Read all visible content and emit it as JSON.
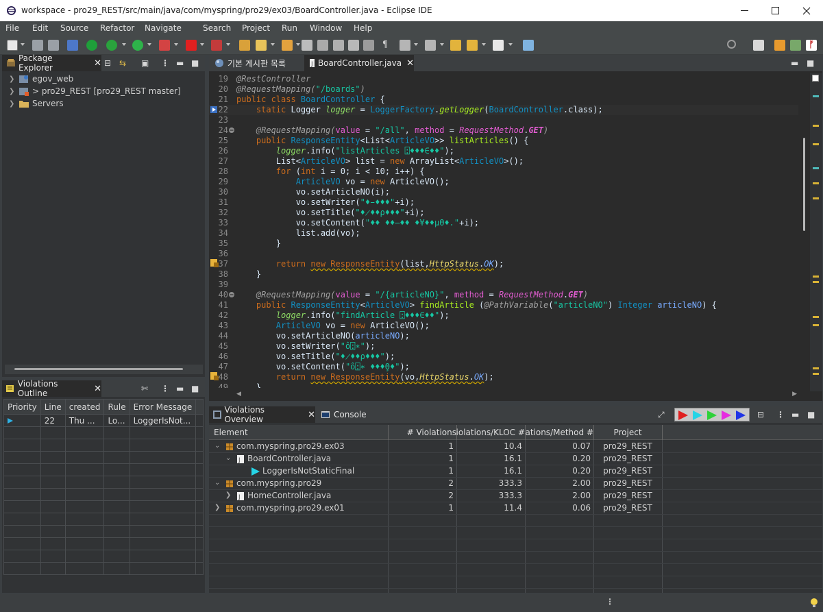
{
  "window": {
    "title": "workspace - pro29_REST/src/main/java/com/myspring/pro29/ex03/BoardController.java - Eclipse IDE"
  },
  "menu": [
    "File",
    "Edit",
    "Source",
    "Refactor",
    "Navigate",
    "Search",
    "Project",
    "Run",
    "Window",
    "Help"
  ],
  "package_explorer": {
    "tab_label": "Package Explorer",
    "items": [
      {
        "label": "egov_web"
      },
      {
        "label": "> pro29_REST [pro29_REST master]"
      },
      {
        "label": "Servers"
      }
    ]
  },
  "editor": {
    "tabs": [
      {
        "label": "기본 게시판 목록"
      },
      {
        "label": "BoardController.java"
      }
    ],
    "line_numbers": [
      "19",
      "20",
      "21",
      "22",
      "23",
      "24",
      "25",
      "26",
      "27",
      "28",
      "29",
      "30",
      "31",
      "32",
      "33",
      "34",
      "35",
      "36",
      "37",
      "38",
      "39",
      "40",
      "41",
      "42",
      "43",
      "44",
      "45",
      "46",
      "47",
      "48",
      "49"
    ],
    "code": {
      "l19": "@RestController",
      "l20a": "@RequestMapping(",
      "l20b": "\"/boards\"",
      "l20c": ")",
      "l21a": "public class ",
      "l21b": "BoardController",
      "l21c": " {",
      "l22a": "    static ",
      "l22b": "Logger ",
      "l22c": "logger",
      "l22d": " = ",
      "l22e": "LoggerFactory",
      "l22f": ".",
      "l22g": "getLogger",
      "l22h": "(",
      "l22i": "BoardController",
      "l22j": ".class);",
      "l24a": "    @RequestMapping(",
      "l24b": "value",
      "l24c": " = ",
      "l24d": "\"/all\"",
      "l24e": ", ",
      "l24f": "method",
      "l24g": " = ",
      "l24h": "RequestMethod",
      "l24i": ".",
      "l24j": "GET",
      "l24k": ")",
      "l25a": "    public ",
      "l25b": "ResponseEntity",
      "l25c": "<",
      "l25d": "List",
      "l25e": "<",
      "l25f": "ArticleVO",
      "l25g": ">> ",
      "l25h": "listArticles",
      "l25i": "() {",
      "l26a": "        ",
      "l26b": "logger",
      "l26c": ".info(",
      "l26d": "\"listArticles ⍠♦♦♦∈♦♦\"",
      "l26e": ");",
      "l27a": "        List<",
      "l27b": "ArticleVO",
      "l27c": "> ",
      "l27d": "list",
      "l27e": " = ",
      "l27f": "new ",
      "l27g": "ArrayList",
      "l27h": "<",
      "l27i": "ArticleVO",
      "l27j": ">();",
      "l28a": "        ",
      "l28b": "for ",
      "l28c": "(",
      "l28d": "int ",
      "l28e": "i",
      "l28f": " = ",
      "l28g": "0",
      "l28h": "; ",
      "l28i": "i",
      "l28j": " < ",
      "l28k": "10",
      "l28l": "; ",
      "l28m": "i",
      "l28n": "++) {",
      "l29a": "            ",
      "l29b": "ArticleVO ",
      "l29c": "vo",
      "l29d": " = ",
      "l29e": "new ",
      "l29f": "ArticleVO",
      "l29g": "();",
      "l30a": "            vo.setArticleNO(i);",
      "l31a": "            vo.setWriter(",
      "l31b": "\"♦̵♦♦♦\"",
      "l31c": "+i);",
      "l32a": "            vo.setTitle(",
      "l32b": "\"♦̷♦♦ρ♦♦♦\"",
      "l32c": "+i);",
      "l33a": "            vo.setContent(",
      "l33b": "\"♦♦ ♦♦̶♦♦ ♦¥♦♦μΘ♦.\"",
      "l33c": "+i);",
      "l34a": "            list.add(vo);",
      "l35a": "        }",
      "l37a": "        ",
      "l37b": "return ",
      "l37c": "new ResponseEntity",
      "l37d": "(list,",
      "l37e": "HttpStatus",
      "l37f": ".",
      "l37g": "OK",
      "l37h": ");",
      "l38a": "    }",
      "l40a": "    @RequestMapping(",
      "l40b": "value",
      "l40c": " = ",
      "l40d": "\"/{articleNO}\"",
      "l40e": ", ",
      "l40f": "method",
      "l40g": " = ",
      "l40h": "RequestMethod",
      "l40i": ".",
      "l40j": "GET",
      "l40k": ")",
      "l41a": "    public ",
      "l41b": "ResponseEntity",
      "l41c": "<",
      "l41d": "ArticleVO",
      "l41e": "> ",
      "l41f": "findArticle",
      "l41g": " (",
      "l41h": "@PathVariable",
      "l41i": "(",
      "l41j": "\"articleNO\"",
      "l41k": ") ",
      "l41l": "Integer ",
      "l41m": "articleNO",
      "l41n": ") {",
      "l42a": "        ",
      "l42b": "logger",
      "l42c": ".info(",
      "l42d": "\"findArticle ⍠♦♦♦∈♦♦\"",
      "l42e": ");",
      "l43a": "        ",
      "l43b": "ArticleVO ",
      "l43c": "vo",
      "l43d": " = ",
      "l43e": "new ",
      "l43f": "ArticleVO",
      "l43g": "();",
      "l44a": "        vo.setArticleNO(",
      "l44b": "articleNO",
      "l44c": ");",
      "l45a": "        vo.setWriter(",
      "l45b": "\"ô⍠∗\"",
      "l45c": ");",
      "l46a": "        vo.setTitle(",
      "l46b": "\"♦̷♦♦ρ♦♦♦\"",
      "l46c": ");",
      "l47a": "        vo.setContent(",
      "l47b": "\"ô⍠∗ ♦♦♦̧Θ♦\"",
      "l47c": ");",
      "l48a": "        ",
      "l48b": "return ",
      "l48c": "new ResponseEntity",
      "l48d": "(vo,",
      "l48e": "HttpStatus",
      "l48f": ".",
      "l48g": "OK",
      "l48h": ");",
      "l49a": "    }"
    }
  },
  "violations_outline": {
    "tab_label": "Violations Outline",
    "columns": [
      "Priority",
      "Line",
      "created",
      "Rule",
      "Error Message"
    ],
    "rows": [
      {
        "line": "22",
        "created": "Thu ...",
        "rule": "Lo...",
        "message": "LoggerIsNot..."
      }
    ]
  },
  "bottom_tabs": [
    {
      "label": "Violations Overview"
    },
    {
      "label": "Console"
    }
  ],
  "violations_overview": {
    "columns": [
      "Element",
      "# Violations",
      "# Violations/KLOC",
      "# Violations/Method",
      "Project"
    ],
    "rows": [
      {
        "element": "com.myspring.pro29.ex03",
        "violations": "1",
        "kloc": "10.4",
        "method": "0.07",
        "project": "pro29_REST",
        "level": 0,
        "icon": "package-icon",
        "expanded": "open"
      },
      {
        "element": "BoardController.java",
        "violations": "1",
        "kloc": "16.1",
        "method": "0.20",
        "project": "pro29_REST",
        "level": 1,
        "icon": "java-file-icon",
        "expanded": "open"
      },
      {
        "element": "LoggerIsNotStaticFinal",
        "violations": "1",
        "kloc": "16.1",
        "method": "0.20",
        "project": "pro29_REST",
        "level": 2,
        "icon": "rule-icon",
        "expanded": "none"
      },
      {
        "element": "com.myspring.pro29",
        "violations": "2",
        "kloc": "333.3",
        "method": "2.00",
        "project": "pro29_REST",
        "level": 0,
        "icon": "package-icon",
        "expanded": "open"
      },
      {
        "element": "HomeController.java",
        "violations": "2",
        "kloc": "333.3",
        "method": "2.00",
        "project": "pro29_REST",
        "level": 1,
        "icon": "java-file-icon",
        "expanded": "closed"
      },
      {
        "element": "com.myspring.pro29.ex01",
        "violations": "1",
        "kloc": "11.4",
        "method": "0.06",
        "project": "pro29_REST",
        "level": 0,
        "icon": "package-icon",
        "expanded": "closed"
      }
    ]
  },
  "colors": {
    "accent": "#2f65ca",
    "keyword": "#cc6c1d",
    "string": "#17c6a3",
    "type": "#1290c3"
  }
}
